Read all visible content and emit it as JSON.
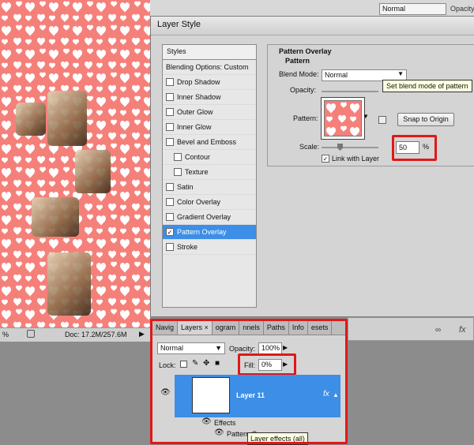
{
  "top_strip": {
    "blend": "Normal",
    "opacity_label": "Opacity"
  },
  "dialog": {
    "title": "Layer Style",
    "styles_header": "Styles",
    "styles": [
      {
        "label": "Blending Options: Custom",
        "checkbox": false,
        "checked": false,
        "indent": false,
        "active": false
      },
      {
        "label": "Drop Shadow",
        "checkbox": true,
        "checked": false,
        "indent": false,
        "active": false
      },
      {
        "label": "Inner Shadow",
        "checkbox": true,
        "checked": false,
        "indent": false,
        "active": false
      },
      {
        "label": "Outer Glow",
        "checkbox": true,
        "checked": false,
        "indent": false,
        "active": false
      },
      {
        "label": "Inner Glow",
        "checkbox": true,
        "checked": false,
        "indent": false,
        "active": false
      },
      {
        "label": "Bevel and Emboss",
        "checkbox": true,
        "checked": false,
        "indent": false,
        "active": false
      },
      {
        "label": "Contour",
        "checkbox": true,
        "checked": false,
        "indent": true,
        "active": false
      },
      {
        "label": "Texture",
        "checkbox": true,
        "checked": false,
        "indent": true,
        "active": false
      },
      {
        "label": "Satin",
        "checkbox": true,
        "checked": false,
        "indent": false,
        "active": false
      },
      {
        "label": "Color Overlay",
        "checkbox": true,
        "checked": false,
        "indent": false,
        "active": false
      },
      {
        "label": "Gradient Overlay",
        "checkbox": true,
        "checked": false,
        "indent": false,
        "active": false
      },
      {
        "label": "Pattern Overlay",
        "checkbox": true,
        "checked": true,
        "indent": false,
        "active": true
      },
      {
        "label": "Stroke",
        "checkbox": true,
        "checked": false,
        "indent": false,
        "active": false
      }
    ],
    "section_title": "Pattern Overlay",
    "sub_title": "Pattern",
    "blend_mode_label": "Blend Mode:",
    "blend_mode_value": "Normal",
    "opacity_label": "Opacity:",
    "pattern_label": "Pattern:",
    "snap_button": "Snap to Origin",
    "scale_label": "Scale:",
    "scale_value": "50",
    "scale_unit": "%",
    "link_label": "Link with Layer",
    "tooltip": "Set blend mode of pattern"
  },
  "status": {
    "zoom": "%",
    "doc": "Doc: 17.2M/257.6M"
  },
  "layers_panel": {
    "tabs": [
      "Navig",
      "Layers ×",
      "ogram",
      "nnels",
      "Paths",
      "Info",
      "esets"
    ],
    "blend": "Normal",
    "opacity_label": "Opacity:",
    "opacity_value": "100%",
    "lock_label": "Lock:",
    "fill_label": "Fill:",
    "fill_value": "0%",
    "layer_name": "Layer 11",
    "fx_label": "fx",
    "effects_label": "Effects",
    "pattern_item": "Pattern O",
    "tooltip": "Layer effects (all)"
  },
  "colors": {
    "canvas": "#f5807a",
    "accent": "#3d8ee6",
    "highlight": "#e01818"
  }
}
